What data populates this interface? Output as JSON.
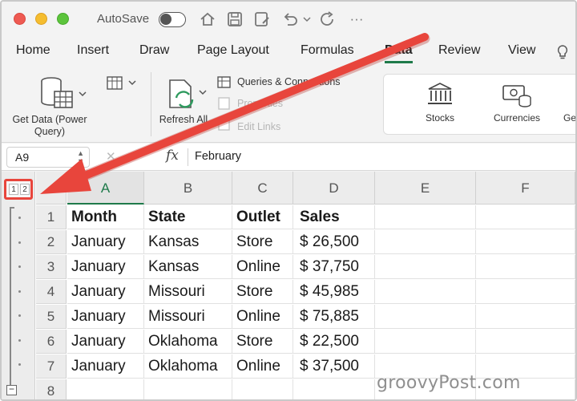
{
  "titlebar": {
    "autosave_label": "AutoSave",
    "icons": [
      "home-icon",
      "save-icon",
      "save-as-icon",
      "undo-icon",
      "redo-icon",
      "more-icon"
    ]
  },
  "tabs": [
    {
      "label": "Home"
    },
    {
      "label": "Insert"
    },
    {
      "label": "Draw"
    },
    {
      "label": "Page Layout"
    },
    {
      "label": "Formulas"
    },
    {
      "label": "Data",
      "active": true
    },
    {
      "label": "Review"
    },
    {
      "label": "View"
    }
  ],
  "ribbon": {
    "get_data_label": "Get Data (Power Query)",
    "refresh_label": "Refresh All",
    "queries_label": "Queries & Connections",
    "properties_label": "Properties",
    "edit_links_label": "Edit Links",
    "stocks_label": "Stocks",
    "currencies_label": "Currencies",
    "geography_label": "Ge"
  },
  "formula_bar": {
    "name_box": "A9",
    "fx_label": "fx",
    "formula": "February"
  },
  "outline": {
    "levels": [
      "1",
      "2"
    ],
    "collapse_symbol": "−"
  },
  "columns": [
    "A",
    "B",
    "C",
    "D",
    "E",
    "F"
  ],
  "rows": [
    {
      "num": "1",
      "cells": [
        "Month",
        "State",
        "Outlet",
        "Sales"
      ],
      "header": true
    },
    {
      "num": "2",
      "cells": [
        "January",
        "Kansas",
        "Store",
        "$ 26,500"
      ]
    },
    {
      "num": "3",
      "cells": [
        "January",
        "Kansas",
        "Online",
        "$ 37,750"
      ]
    },
    {
      "num": "4",
      "cells": [
        "January",
        "Missouri",
        "Store",
        "$ 45,985"
      ]
    },
    {
      "num": "5",
      "cells": [
        "January",
        "Missouri",
        "Online",
        "$ 75,885"
      ]
    },
    {
      "num": "6",
      "cells": [
        "January",
        "Oklahoma",
        "Store",
        "$ 22,500"
      ]
    },
    {
      "num": "7",
      "cells": [
        "January",
        "Oklahoma",
        "Online",
        "$ 37,500"
      ]
    },
    {
      "num": "8",
      "cells": [
        "",
        "",
        "",
        ""
      ]
    }
  ],
  "watermark": "groovyPost.com",
  "colors": {
    "accent_green": "#1f7a4a",
    "annotation_red": "#e8453c"
  }
}
